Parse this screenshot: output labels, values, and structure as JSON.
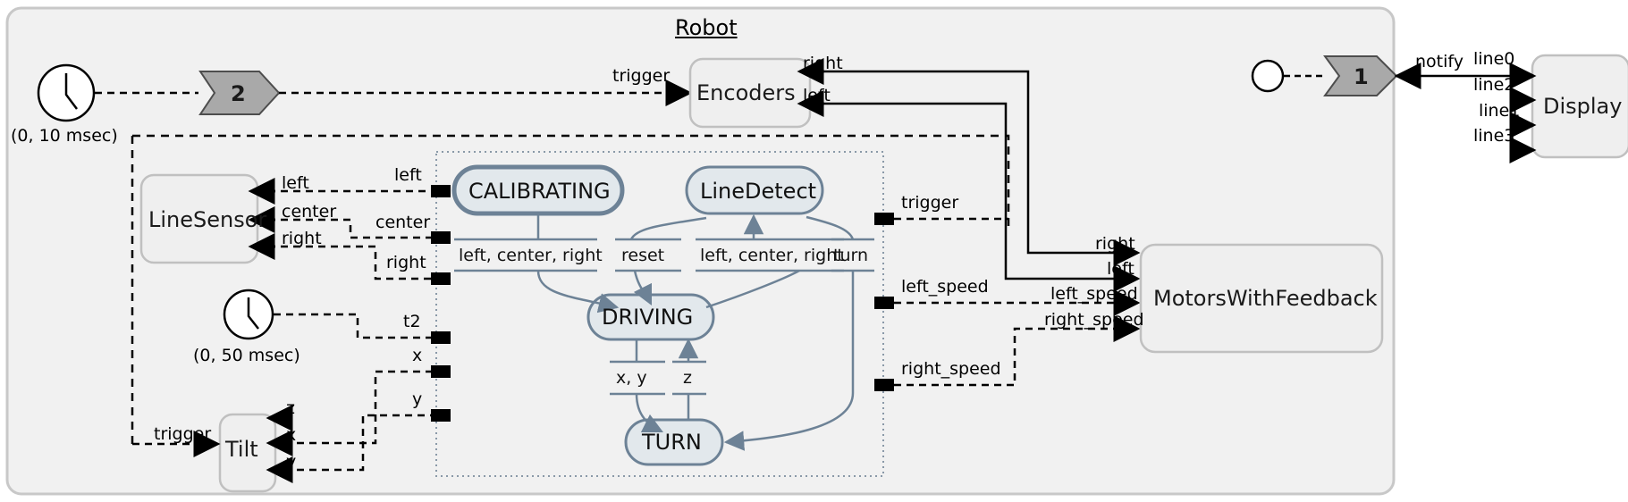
{
  "diagram": {
    "title": "Robot",
    "container_name": "Robot"
  },
  "clocks": [
    {
      "name": "clock-top",
      "caption": "(0, 10 msec)"
    },
    {
      "name": "clock-mid",
      "caption": "(0, 50 msec)"
    }
  ],
  "priority_markers": [
    {
      "label": "2"
    },
    {
      "label": "1"
    }
  ],
  "blocks": {
    "encoders": {
      "label": "Encoders",
      "inputs": [
        "trigger"
      ],
      "outputs": [
        "right",
        "left"
      ]
    },
    "line_sensor": {
      "label": "LineSensor",
      "outputs": [
        "left",
        "center",
        "right"
      ]
    },
    "tilt": {
      "label": "Tilt",
      "inputs": [
        "trigger"
      ],
      "outputs": [
        "z",
        "x",
        "y"
      ]
    },
    "motors": {
      "label": "MotorsWithFeedback",
      "inputs": [
        "right",
        "left",
        "left_speed",
        "right_speed"
      ]
    },
    "display": {
      "label": "Display",
      "inputs": [
        "line0",
        "line2",
        "line1",
        "line3"
      ]
    }
  },
  "notify_label": "notify",
  "statechart": {
    "states": [
      {
        "label": "CALIBRATING",
        "initial": true
      },
      {
        "label": "LineDetect",
        "initial": false
      },
      {
        "label": "DRIVING",
        "initial": false
      },
      {
        "label": "TURN",
        "initial": false
      }
    ],
    "transitions": [
      {
        "label": "left, center, right"
      },
      {
        "label": "reset"
      },
      {
        "label": "left, center, right"
      },
      {
        "label": "turn"
      },
      {
        "label": "x, y"
      },
      {
        "label": "z"
      }
    ],
    "input_ports": [
      {
        "label": "left"
      },
      {
        "label": "center"
      },
      {
        "label": "right"
      },
      {
        "label": "t2"
      },
      {
        "label": "x"
      },
      {
        "label": "y"
      }
    ],
    "output_ports": [
      {
        "label": "trigger"
      },
      {
        "label": "left_speed"
      },
      {
        "label": "right_speed"
      }
    ]
  },
  "colors": {
    "container_fill": "#f1f1f1",
    "container_stroke": "#c8c8c8",
    "block_fill": "#efefef",
    "block_stroke": "#c0c0c0",
    "state_fill": "#e2e8ec",
    "state_stroke": "#6d8296",
    "priority_fill": "#a9a9a9",
    "priority_stroke": "#4d4d4d",
    "line": "#000000",
    "state_line": "#6d8296"
  }
}
